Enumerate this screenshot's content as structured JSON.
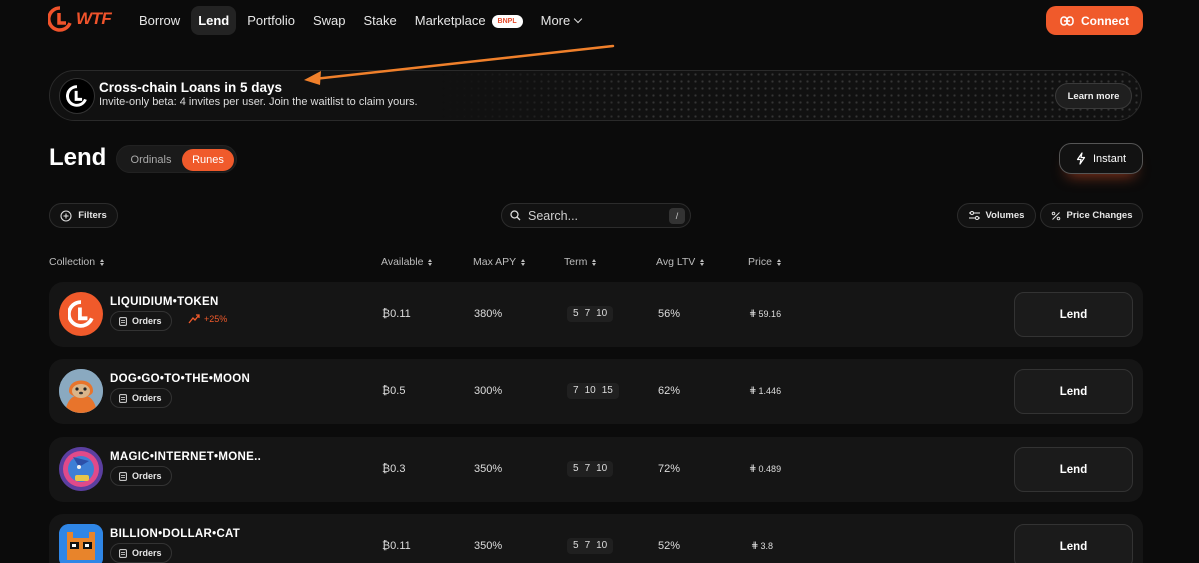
{
  "nav": {
    "logo_text": "WTF",
    "links": [
      "Borrow",
      "Lend",
      "Portfolio",
      "Swap",
      "Stake",
      "Marketplace"
    ],
    "active": "Lend",
    "bnpl_badge": "BNPL",
    "more_label": "More",
    "connect_label": "Connect",
    "accent_color": "#f05a2b"
  },
  "banner": {
    "title": "Cross-chain Loans in 5 days",
    "subtitle": "Invite-only beta: 4 invites per user. Join the waitlist to claim yours.",
    "learn_more": "Learn more"
  },
  "lend": {
    "title": "Lend",
    "tabs": [
      "Ordinals",
      "Runes"
    ],
    "active_tab": "Runes",
    "instant_label": "Instant"
  },
  "toolbar": {
    "filters_label": "Filters",
    "search_placeholder": "Search...",
    "search_shortcut": "/",
    "volumes_label": "Volumes",
    "price_changes_label": "Price Changes"
  },
  "table": {
    "headers": [
      "Collection",
      "Available",
      "Max APY",
      "Term",
      "Avg LTV",
      "Price"
    ],
    "orders_label": "Orders",
    "lend_label": "Lend",
    "rows": [
      {
        "name": "LIQUIDIUM•TOKEN",
        "available": "₿0.11",
        "apy": "380%",
        "terms": [
          "5",
          "7",
          "10"
        ],
        "ltv": "56%",
        "price": "59.16",
        "badge": "+25%",
        "avatar": "liquidium-logo"
      },
      {
        "name": "DOG•GO•TO•THE•MOON",
        "available": "₿0.5",
        "apy": "300%",
        "terms": [
          "7",
          "10",
          "15"
        ],
        "ltv": "62%",
        "price": "1.446",
        "badge": "",
        "avatar": "dog-in-orange-hoodie"
      },
      {
        "name": "MAGIC•INTERNET•MONE..",
        "available": "₿0.3",
        "apy": "350%",
        "terms": [
          "5",
          "7",
          "10"
        ],
        "ltv": "72%",
        "price": "0.489",
        "badge": "",
        "avatar": "wizard-artwork"
      },
      {
        "name": "BILLION•DOLLAR•CAT",
        "available": "₿0.11",
        "apy": "350%",
        "terms": [
          "5",
          "7",
          "10"
        ],
        "ltv": "52%",
        "price": "3.8",
        "badge": "",
        "avatar": "pixel-cat"
      }
    ]
  }
}
